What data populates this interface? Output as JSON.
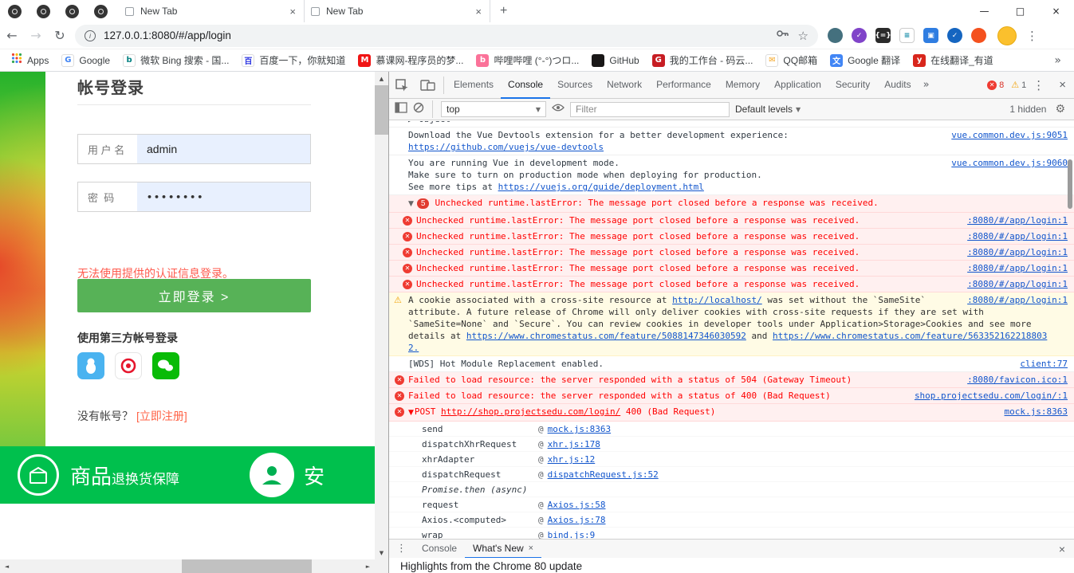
{
  "colors": {
    "button_green": "#57b257",
    "banner_green": "#00c04d",
    "login_error_red": "#ff5a4d",
    "register_orange": "#ff6347",
    "autofill_blue": "#e8f0fe",
    "dt_accent_blue": "#1a73e8",
    "dt_link_blue": "#1155cc",
    "dt_error_text": "#ff0000",
    "dt_error_bg": "#fff0f0",
    "dt_warn_bg": "#fffbe5",
    "dt_badge_red": "#e13b30"
  },
  "window": {
    "pinned_tabs": 4,
    "tabs": [
      {
        "label": "New Tab"
      },
      {
        "label": "New Tab"
      }
    ]
  },
  "address_bar": {
    "url": "127.0.0.1:8080/#/app/login",
    "extensions": [
      {
        "name": "extension-globe-icon",
        "bg": "#44707e",
        "fg": "#ffffff",
        "glyph": "",
        "round": true
      },
      {
        "name": "extension-purple-check-icon",
        "bg": "#8044c9",
        "fg": "#ffffff",
        "glyph": "✓",
        "round": true
      },
      {
        "name": "extension-braces-icon",
        "bg": "#2b2b2b",
        "fg": "#ffffff",
        "glyph": "{=}",
        "round": false
      },
      {
        "name": "extension-list-icon",
        "bg": "#ffffff",
        "fg": "#0b87a5",
        "glyph": "≡",
        "round": false,
        "border": true
      },
      {
        "name": "extension-blue-square-icon",
        "bg": "#2f7de1",
        "fg": "#ffffff",
        "glyph": "▣",
        "round": false
      },
      {
        "name": "extension-shield-check-icon",
        "bg": "#1565c0",
        "fg": "#ffffff",
        "glyph": "✓",
        "round": true
      },
      {
        "name": "extension-orange-dot-icon",
        "bg": "#f4511e",
        "fg": "#ffffff",
        "glyph": "",
        "round": true
      }
    ]
  },
  "bookmarks_bar": {
    "apps_label": "Apps",
    "overflow_glyph": "»",
    "items": [
      {
        "label": "Google",
        "icon": "google-icon",
        "bg": "#ffffff",
        "fg": "#4285f4",
        "glyph": "G",
        "border": true
      },
      {
        "label": "微软 Bing 搜索 - 国...",
        "icon": "bing-icon",
        "bg": "#ffffff",
        "fg": "#008080",
        "glyph": "b",
        "border": true
      },
      {
        "label": "百度一下，你就知道",
        "icon": "baidu-icon",
        "bg": "#ffffff",
        "fg": "#2932e1",
        "glyph": "百",
        "border": true
      },
      {
        "label": "慕课网-程序员的梦...",
        "icon": "imooc-icon",
        "bg": "#f01414",
        "fg": "#ffffff",
        "glyph": "M"
      },
      {
        "label": "哔哩哔哩 (°-°)つロ...",
        "icon": "bilibili-icon",
        "bg": "#fb7299",
        "fg": "#ffffff",
        "glyph": "b"
      },
      {
        "label": "GitHub",
        "icon": "github-icon",
        "bg": "#191717",
        "fg": "#ffffff",
        "glyph": ""
      },
      {
        "label": "我的工作台 - 码云...",
        "icon": "gitee-icon",
        "bg": "#c71d23",
        "fg": "#ffffff",
        "glyph": "G"
      },
      {
        "label": "QQ邮箱",
        "icon": "qqmail-icon",
        "bg": "#ffffff",
        "fg": "#f5a623",
        "glyph": "✉",
        "border": true
      },
      {
        "label": "Google 翻译",
        "icon": "google-translate-icon",
        "bg": "#4286f5",
        "fg": "#ffffff",
        "glyph": "文"
      },
      {
        "label": "在线翻译_有道",
        "icon": "youdao-icon",
        "bg": "#d8261c",
        "fg": "#ffffff",
        "glyph": "y"
      }
    ]
  },
  "login_page": {
    "heading": "帐号登录",
    "username_label": "用 户 名",
    "username_value": "admin",
    "password_label": "密  码",
    "password_value": "••••••••",
    "error_message": "无法使用提供的认证信息登录。",
    "submit_label": "立即登录 >",
    "third_party_heading": "使用第三方帐号登录",
    "social_icons": [
      "qq-icon",
      "weibo-icon",
      "wechat-icon"
    ],
    "register_prompt": "没有帐号？",
    "register_link": "[立即注册]",
    "banner": {
      "item1_title": "商品",
      "item1_subtitle": "退换货保障",
      "item2_title": "安"
    }
  },
  "devtools": {
    "main_tabs": [
      {
        "label": "Elements"
      },
      {
        "label": "Console",
        "active": true
      },
      {
        "label": "Sources"
      },
      {
        "label": "Network"
      },
      {
        "label": "Performance"
      },
      {
        "label": "Memory"
      },
      {
        "label": "Application"
      },
      {
        "label": "Security"
      },
      {
        "label": "Audits"
      }
    ],
    "more_tabs_glyph": "»",
    "error_count": "8",
    "warning_count": "1",
    "toolbar": {
      "context": "top",
      "filter_placeholder": "Filter",
      "levels": "Default levels",
      "hidden": "1 hidden"
    },
    "messages": [
      {
        "kind": "log",
        "clipped": true,
        "source": "",
        "lines": [
          [
            {
              "t": "▶ Object"
            }
          ]
        ]
      },
      {
        "kind": "log",
        "source": "vue.common.dev.js:9051",
        "lines": [
          [
            {
              "t": "Download the Vue Devtools extension for a better development experience:"
            }
          ],
          [
            {
              "t": "https://github.com/vuejs/vue-devtools",
              "link": true
            }
          ]
        ]
      },
      {
        "kind": "log",
        "source": "vue.common.dev.js:9060",
        "lines": [
          [
            {
              "t": "You are running Vue in development mode."
            }
          ],
          [
            {
              "t": "Make sure to turn on production mode when deploying for production."
            }
          ],
          [
            {
              "t": "See more tips at "
            },
            {
              "t": "https://vuejs.org/guide/deployment.html",
              "link": true
            }
          ]
        ]
      },
      {
        "kind": "error-group",
        "badge": "5",
        "source": "",
        "lines": [
          [
            {
              "t": "Unchecked runtime.lastError: The message port closed before a response was received."
            }
          ]
        ]
      },
      {
        "kind": "error",
        "child": true,
        "source": ":8080/#/app/login:1",
        "lines": [
          [
            {
              "t": "Unchecked runtime.lastError: The message port closed before a response was received."
            }
          ]
        ]
      },
      {
        "kind": "error",
        "child": true,
        "source": ":8080/#/app/login:1",
        "lines": [
          [
            {
              "t": "Unchecked runtime.lastError: The message port closed before a response was received."
            }
          ]
        ]
      },
      {
        "kind": "error",
        "child": true,
        "source": ":8080/#/app/login:1",
        "lines": [
          [
            {
              "t": "Unchecked runtime.lastError: The message port closed before a response was received."
            }
          ]
        ]
      },
      {
        "kind": "error",
        "child": true,
        "source": ":8080/#/app/login:1",
        "lines": [
          [
            {
              "t": "Unchecked runtime.lastError: The message port closed before a response was received."
            }
          ]
        ]
      },
      {
        "kind": "error",
        "child": true,
        "source": ":8080/#/app/login:1",
        "lines": [
          [
            {
              "t": "Unchecked runtime.lastError: The message port closed before a response was received."
            }
          ]
        ]
      },
      {
        "kind": "warning",
        "source": ":8080/#/app/login:1",
        "lines": [
          [
            {
              "t": "A cookie associated with a cross-site resource at "
            },
            {
              "t": "http://localhost/",
              "link": true
            },
            {
              "t": " was set without the `SameSite`"
            }
          ],
          [
            {
              "t": "attribute. A future release of Chrome will only deliver cookies with cross-site requests if they are set with"
            }
          ],
          [
            {
              "t": "`SameSite=None` and `Secure`. You can review cookies in developer tools under Application>Storage>Cookies and see more"
            }
          ],
          [
            {
              "t": "details at "
            },
            {
              "t": "https://www.chromestatus.com/feature/5088147346030592",
              "link": true
            },
            {
              "t": " and "
            },
            {
              "t": "https://www.chromestatus.com/feature/563352162218803",
              "link": true
            }
          ],
          [
            {
              "t": "2.",
              "link": true
            }
          ]
        ]
      },
      {
        "kind": "log",
        "source": "client:77",
        "lines": [
          [
            {
              "t": "[WDS] Hot Module Replacement enabled."
            }
          ]
        ]
      },
      {
        "kind": "error",
        "source": ":8080/favicon.ico:1",
        "lines": [
          [
            {
              "t": "Failed to load resource: the server responded with a status of 504 (Gateway Timeout)"
            }
          ]
        ]
      },
      {
        "kind": "error",
        "source": "shop.projectsedu.com/login/:1",
        "lines": [
          [
            {
              "t": "Failed to load resource: the server responded with a status of 400 (Bad Request)"
            }
          ]
        ]
      },
      {
        "kind": "error-trace",
        "caret": "▼",
        "source": "mock.js:8363",
        "lines": [
          [
            {
              "t": "POST "
            },
            {
              "t": "http://shop.projectsedu.com/login/",
              "link": true
            },
            {
              "t": " 400 (Bad Request)"
            }
          ]
        ],
        "stack": [
          {
            "fn": "send",
            "loc": "mock.js:8363"
          },
          {
            "fn": "dispatchXhrRequest",
            "loc": "xhr.js:178"
          },
          {
            "fn": "xhrAdapter",
            "loc": "xhr.js:12"
          },
          {
            "fn": "dispatchRequest",
            "loc": "dispatchRequest.js:52"
          },
          {
            "fn": "Promise.then (async)",
            "loc": "",
            "async": true
          },
          {
            "fn": "request",
            "loc": "Axios.js:58"
          },
          {
            "fn": "Axios.<computed>",
            "loc": "Axios.js:78"
          },
          {
            "fn": "wrap",
            "loc": "bind.js:9"
          }
        ]
      }
    ],
    "drawer": {
      "tabs": [
        {
          "label": "Console"
        },
        {
          "label": "What's New",
          "active": true,
          "closable": true
        }
      ],
      "content_heading": "Highlights from the Chrome 80 update"
    }
  }
}
